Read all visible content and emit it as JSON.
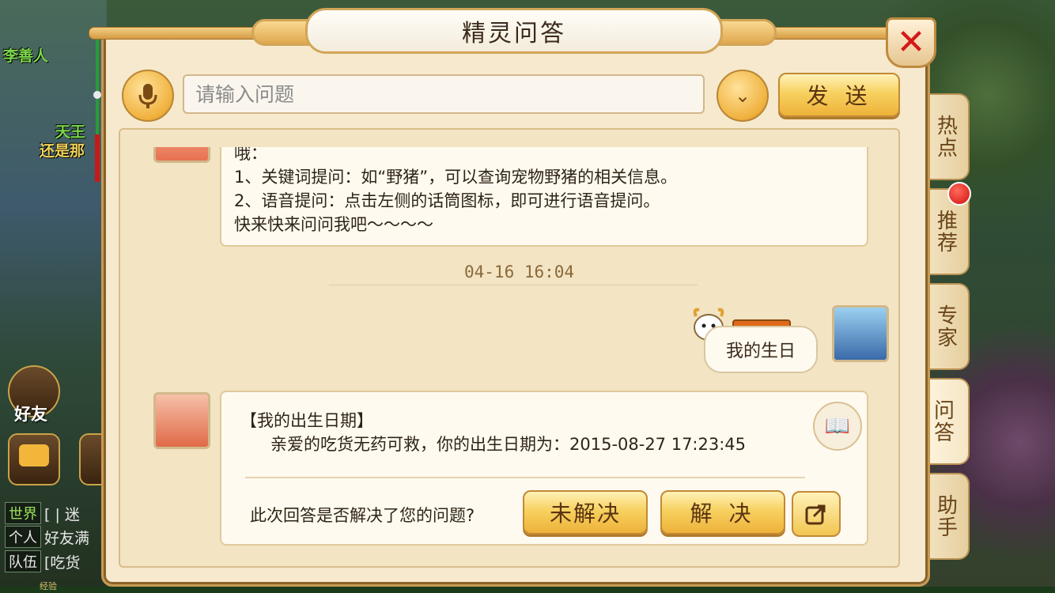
{
  "window": {
    "title": "精灵问答",
    "close_icon": "close-icon"
  },
  "search": {
    "placeholder": "请输入问题",
    "send_label": "发 送"
  },
  "side_tabs": [
    {
      "label": "热点",
      "active": false
    },
    {
      "label": "推荐",
      "active": false,
      "badge": true
    },
    {
      "label": "专家",
      "active": false
    },
    {
      "label": "问答",
      "active": true
    },
    {
      "label": "助手",
      "active": false
    }
  ],
  "chat": {
    "intro_lines": [
      "哦：",
      "1、关键词提问：如“野猪”，可以查询宠物野猪的相关信息。",
      "2、语音提问：点击左侧的话筒图标，即可进行语音提问。",
      "快来快来问问我吧～～～～"
    ],
    "timestamp": "04-16 16:04",
    "user_message": "我的生日",
    "answer": {
      "title": "【我的出生日期】",
      "body": "亲爱的吃货无药可救，你的出生日期为：2015-08-27 17:23:45",
      "question": "此次回答是否解决了您的问题?",
      "unresolved_label": "未解决",
      "resolved_label": "解 决"
    }
  },
  "background": {
    "npc_names": [
      "李善人",
      "天王",
      "还是那"
    ],
    "hud": {
      "friends_label": "好友"
    },
    "chat_rows": [
      {
        "tag": "世界",
        "text": "[ | 迷"
      },
      {
        "tag": "个人",
        "text": "好友满"
      },
      {
        "tag": "队伍",
        "text": "[吃货"
      }
    ],
    "exp_label": "经验"
  },
  "colors": {
    "accent_gold": "#f0b13d",
    "close_red": "#d41818",
    "badge_red": "#d01010",
    "panel_bg": "#f6e9cd"
  }
}
